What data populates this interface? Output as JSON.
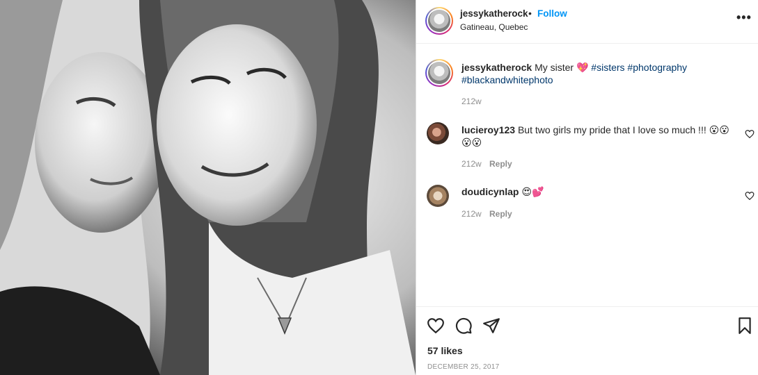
{
  "post": {
    "author": "jessykatherock",
    "separator": "•",
    "follow_label": "Follow",
    "location": "Gatineau, Quebec",
    "more_label": "•••",
    "caption": {
      "text": "My sister 💖",
      "tags": [
        "#sisters",
        "#photography",
        "#blackandwhitephoto"
      ],
      "time": "212w"
    },
    "comments": [
      {
        "user": "lucieroy123",
        "text": "But two girls my pride that I love so much !!! 😮😮 😮😮",
        "time": "212w",
        "reply_label": "Reply"
      },
      {
        "user": "doudicynlap",
        "text": "😍💕",
        "time": "212w",
        "reply_label": "Reply"
      }
    ],
    "likes": "57 likes",
    "date": "DECEMBER 25, 2017"
  },
  "icons": {
    "like": "heart-icon",
    "comment": "comment-icon",
    "share": "paper-plane-icon",
    "save": "bookmark-icon",
    "more": "more-options-icon"
  },
  "colors": {
    "follow": "#0095f6",
    "hashtag": "#00376b",
    "muted": "#8e8e8e",
    "text": "#262626"
  }
}
